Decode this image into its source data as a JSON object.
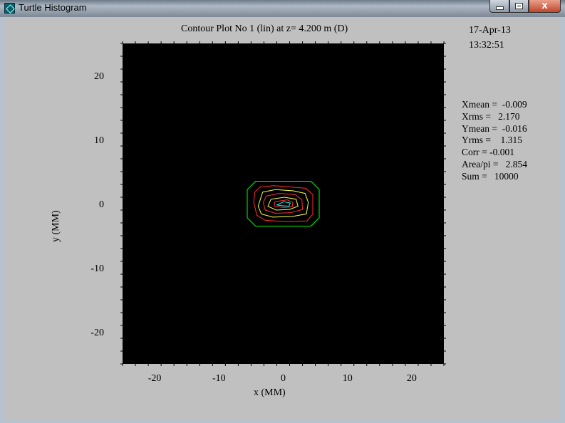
{
  "window": {
    "title": "Turtle Histogram",
    "buttons": {
      "minimize": "minimize",
      "maximize": "maximize",
      "close": "X"
    }
  },
  "header": {
    "plot_title": "Contour Plot No 1 (lin) at z=  4.200 m (D)",
    "date": "17-Apr-13",
    "time": "13:32:51"
  },
  "stats": [
    {
      "label": "Xmean =",
      "value": "-0.009"
    },
    {
      "label": "Xrms =",
      "value": "2.170"
    },
    {
      "label": "Ymean =",
      "value": "-0.016"
    },
    {
      "label": "Yrms =",
      "value": "1.315"
    },
    {
      "label": "Corr =",
      "value": "-0.001"
    },
    {
      "label": "Area/pi =",
      "value": "2.854"
    },
    {
      "label": "Sum =",
      "value": "10000"
    }
  ],
  "chart_data": {
    "type": "contour",
    "xlabel": "x (MM)",
    "ylabel": "y (MM)",
    "xlim": [
      -25,
      25
    ],
    "ylim": [
      -25,
      25
    ],
    "xticks": [
      -20,
      -10,
      0,
      10,
      20
    ],
    "yticks": [
      -20,
      -10,
      0,
      10,
      20
    ],
    "background": "#000000",
    "contours": [
      {
        "color": "#00ff00",
        "points": [
          [
            -4.3,
            3.5
          ],
          [
            4.3,
            3.5
          ],
          [
            5.6,
            2.2
          ],
          [
            5.6,
            -2.2
          ],
          [
            4.3,
            -3.5
          ],
          [
            -4.3,
            -3.5
          ],
          [
            -5.6,
            -2.2
          ],
          [
            -5.6,
            2.2
          ]
        ]
      },
      {
        "color": "#ff3030",
        "points": [
          [
            -3.6,
            2.6
          ],
          [
            -1.5,
            2.8
          ],
          [
            1.2,
            2.6
          ],
          [
            3.5,
            2.4
          ],
          [
            4.6,
            1.4
          ],
          [
            4.6,
            -1.6
          ],
          [
            3.7,
            -2.7
          ],
          [
            0.5,
            -2.8
          ],
          [
            -2.8,
            -2.6
          ],
          [
            -4.1,
            -1.8
          ],
          [
            -4.6,
            0.3
          ],
          [
            -4.4,
            1.8
          ]
        ]
      },
      {
        "color": "#ffff40",
        "points": [
          [
            -3.2,
            1.8
          ],
          [
            -1.2,
            2.2
          ],
          [
            1.6,
            2.0
          ],
          [
            3.4,
            1.6
          ],
          [
            3.9,
            0.2
          ],
          [
            3.6,
            -1.6
          ],
          [
            1.4,
            -2.0
          ],
          [
            -1.6,
            -2.1
          ],
          [
            -3.4,
            -1.6
          ],
          [
            -3.9,
            -0.4
          ]
        ]
      },
      {
        "color": "#ff3030",
        "points": [
          [
            -2.6,
            1.2
          ],
          [
            -0.6,
            1.6
          ],
          [
            1.9,
            1.4
          ],
          [
            2.9,
            0.6
          ],
          [
            3.0,
            -0.9
          ],
          [
            1.2,
            -1.4
          ],
          [
            -1.2,
            -1.5
          ],
          [
            -2.8,
            -1.0
          ],
          [
            -3.1,
            0.2
          ]
        ]
      },
      {
        "color": "#ffff40",
        "points": [
          [
            -1.9,
            0.7
          ],
          [
            0.2,
            1.0
          ],
          [
            2.0,
            0.7
          ],
          [
            2.3,
            -0.4
          ],
          [
            1.0,
            -0.9
          ],
          [
            -1.1,
            -1.0
          ],
          [
            -2.4,
            -0.4
          ]
        ]
      },
      {
        "color": "#ff3030",
        "points": [
          [
            -1.3,
            0.3
          ],
          [
            0.6,
            0.6
          ],
          [
            1.5,
            0.2
          ],
          [
            1.4,
            -0.5
          ],
          [
            0.0,
            -0.6
          ],
          [
            -1.4,
            -0.4
          ]
        ]
      },
      {
        "color": "#00ffff",
        "points": [
          [
            -1.0,
            -0.2
          ],
          [
            0.1,
            0.3
          ],
          [
            1.1,
            0.1
          ],
          [
            0.9,
            -0.4
          ],
          [
            -0.3,
            -0.3
          ]
        ]
      }
    ]
  }
}
